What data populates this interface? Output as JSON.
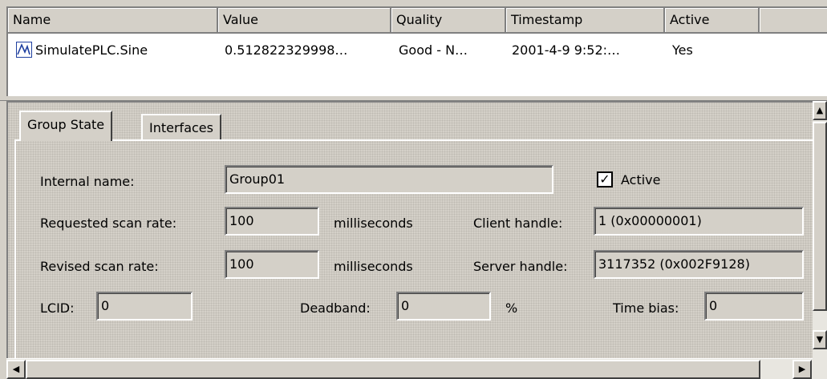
{
  "list": {
    "columns": [
      "Name",
      "Value",
      "Quality",
      "Timestamp",
      "Active"
    ],
    "rows": [
      {
        "icon": "sine-wave-item-icon",
        "name": "SimulatePLC.Sine",
        "value": "0.512822329998…",
        "quality": "Good - N…",
        "timestamp": "2001-4-9 9:52:…",
        "active": "Yes"
      }
    ]
  },
  "tabs": [
    "Group State",
    "Interfaces"
  ],
  "group_state": {
    "internal_name_label": "Internal name:",
    "internal_name": "Group01",
    "active_label": "Active",
    "active_checked": true,
    "requested_scan_rate_label": "Requested scan rate:",
    "requested_scan_rate": "100",
    "revised_scan_rate_label": "Revised scan rate:",
    "revised_scan_rate": "100",
    "milliseconds": "milliseconds",
    "client_handle_label": "Client handle:",
    "client_handle": "1 (0x00000001)",
    "server_handle_label": "Server handle:",
    "server_handle": "3117352 (0x002F9128)",
    "lcid_label": "LCID:",
    "lcid": "0",
    "deadband_label": "Deadband:",
    "deadband": "0",
    "percent": "%",
    "time_bias_label": "Time bias:",
    "time_bias": "0"
  }
}
